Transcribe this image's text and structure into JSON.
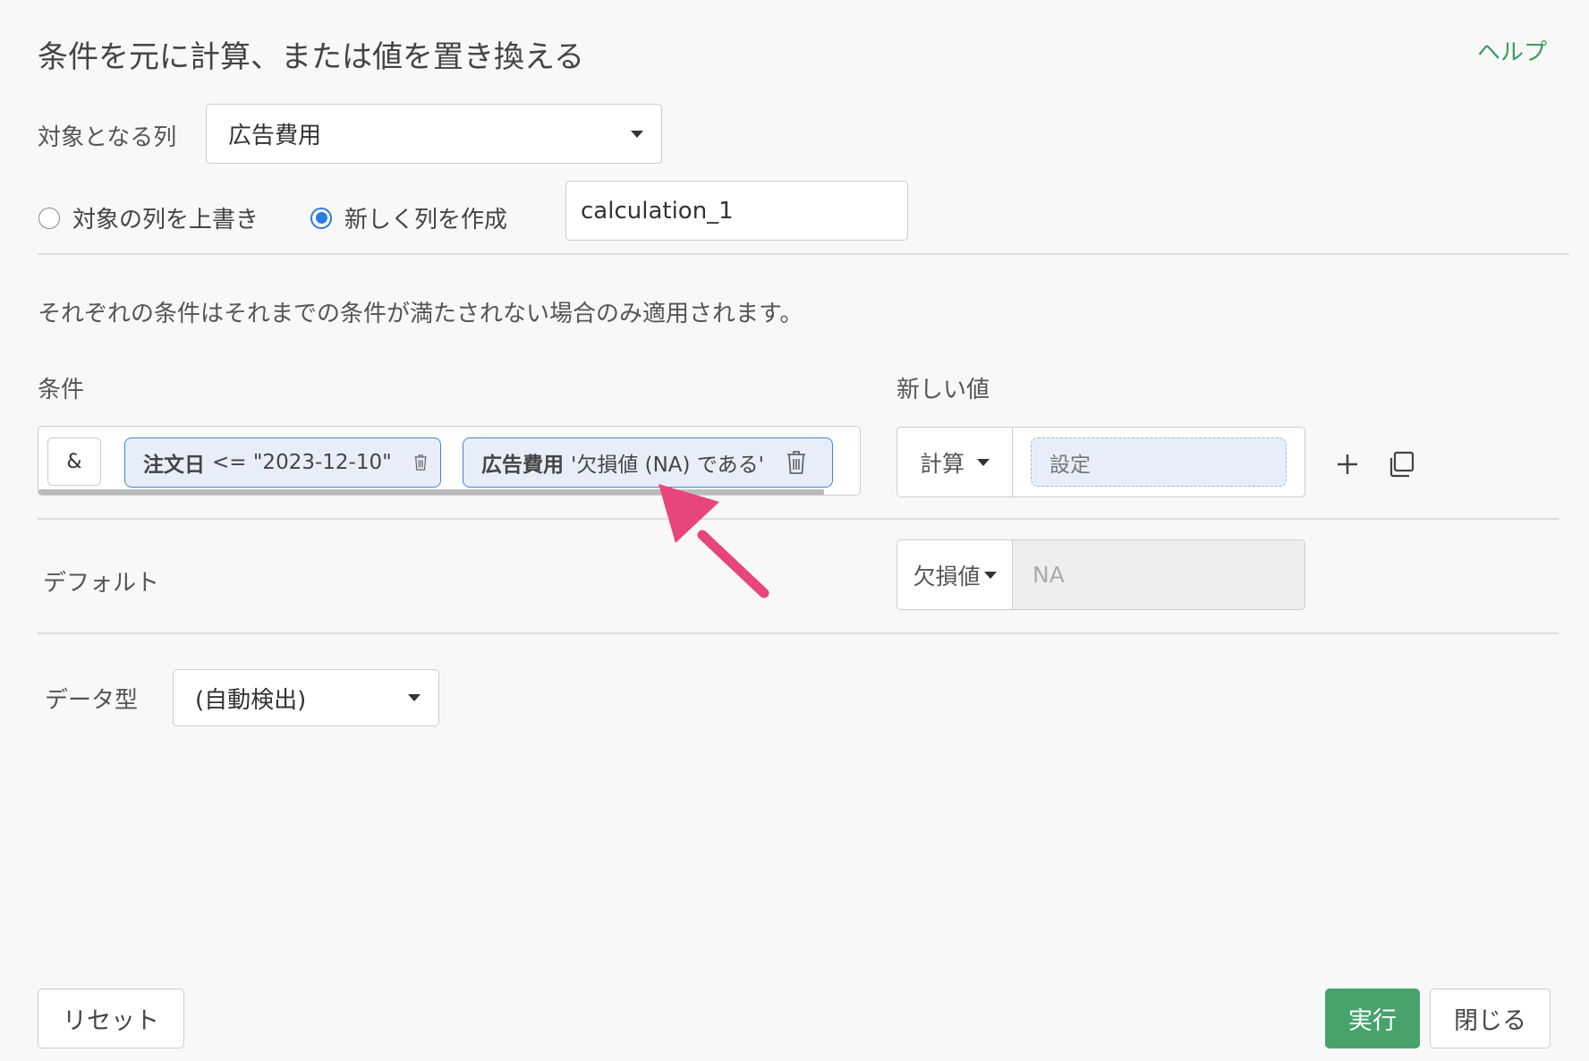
{
  "dialog": {
    "title": "条件を元に計算、または値を置き換える",
    "help_label": "ヘルプ"
  },
  "target_column": {
    "label": "対象となる列",
    "selected": "広告費用"
  },
  "output_mode": {
    "overwrite_label": "対象の列を上書き",
    "create_label": "新しく列を作成",
    "selected": "create",
    "new_column_name": "calculation_1"
  },
  "note": "それぞれの条件はそれまでの条件が満たされない場合のみ適用されます。",
  "conditions": {
    "header": "条件",
    "operator": "&",
    "chips": [
      {
        "column": "注文日",
        "expression": "<= \"2023-12-10\""
      },
      {
        "column": "広告費用",
        "expression": "'欠損値 (NA) である'"
      }
    ]
  },
  "new_value": {
    "header": "新しい値",
    "type_label": "計算",
    "placeholder": "設定",
    "add_icon": "plus-icon",
    "copy_icon": "copy-icon"
  },
  "default": {
    "label": "デフォルト",
    "type_label": "欠損値",
    "value": "NA"
  },
  "data_type": {
    "label": "データ型",
    "selected": "(自動検出)"
  },
  "footer": {
    "reset_label": "リセット",
    "run_label": "実行",
    "close_label": "閉じる"
  },
  "colors": {
    "accent_green": "#47a36b",
    "help_green": "#3a9d5d",
    "chip_border": "#3b86e0",
    "radio_blue": "#2a7de1",
    "arrow_pink": "#e8457a"
  }
}
